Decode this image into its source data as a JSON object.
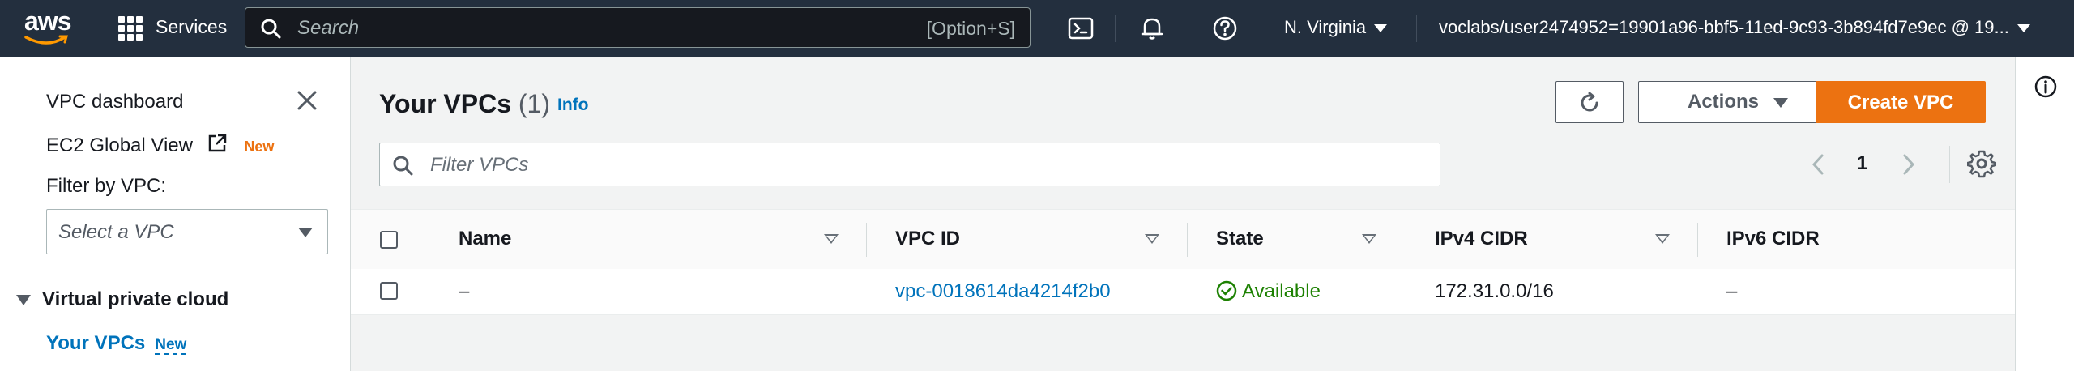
{
  "topnav": {
    "logo_text": "aws",
    "services_label": "Services",
    "search_placeholder": "Search",
    "search_shortcut": "[Option+S]",
    "region_label": "N. Virginia",
    "account_label": "voclabs/user2474952=19901a96-bbf5-11ed-9c93-3b894fd7e9ec @ 19..."
  },
  "sidebar": {
    "dashboard_label": "VPC dashboard",
    "global_view_label": "EC2 Global View",
    "global_view_badge": "New",
    "filter_label": "Filter by VPC:",
    "select_placeholder": "Select a VPC",
    "section_label": "Virtual private cloud",
    "active_item_label": "Your VPCs",
    "active_item_badge": "New"
  },
  "main": {
    "title": "Your VPCs",
    "count": "(1)",
    "info_label": "Info",
    "actions_label": "Actions",
    "create_label": "Create VPC",
    "filter_placeholder": "Filter VPCs",
    "page_number": "1",
    "table": {
      "columns": [
        "Name",
        "VPC ID",
        "State",
        "IPv4 CIDR",
        "IPv6 CIDR"
      ],
      "rows": [
        {
          "name": "–",
          "vpc_id": "vpc-0018614da4214f2b0",
          "state": "Available",
          "ipv4_cidr": "172.31.0.0/16",
          "ipv6_cidr": "–"
        }
      ]
    }
  },
  "colors": {
    "nav_bg": "#232f3e",
    "primary": "#ec7211",
    "link": "#0073bb",
    "success": "#1d8102"
  }
}
